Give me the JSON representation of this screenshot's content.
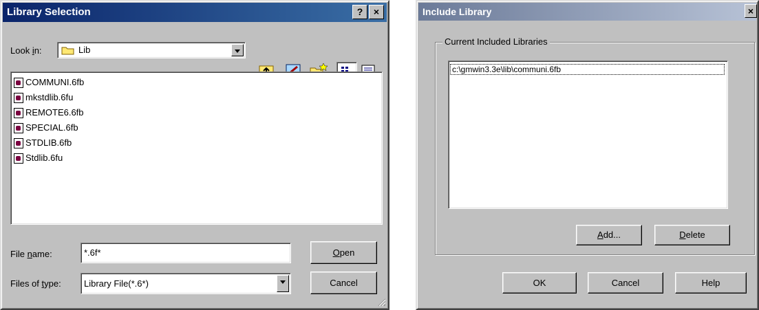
{
  "library_selection": {
    "title": "Library Selection",
    "help_label": "?",
    "close_label": "×",
    "look_in_label_pre": "Look ",
    "look_in_label_accel": "i",
    "look_in_label_post": "n:",
    "look_in_value": "Lib",
    "toolbar_icons": [
      "up-folder-icon",
      "desktop-icon",
      "new-folder-icon",
      "list-view-icon",
      "details-view-icon"
    ],
    "files": [
      "COMMUNI.6fb",
      "mkstdlib.6fu",
      "REMOTE6.6fb",
      "SPECIAL.6fb",
      "STDLIB.6fb",
      "Stdlib.6fu"
    ],
    "file_name_label_pre": "File ",
    "file_name_label_accel": "n",
    "file_name_label_post": "ame:",
    "file_name_value": "*.6f*",
    "files_of_type_label_pre": "Files of ",
    "files_of_type_label_accel": "t",
    "files_of_type_label_post": "ype:",
    "files_of_type_value": "Library File(*.6*)",
    "open_accel": "O",
    "open_rest": "pen",
    "cancel_label": "Cancel"
  },
  "include_library": {
    "title": "Include Library",
    "close_label": "×",
    "group_caption": "Current Included Libraries",
    "libraries": [
      "c:\\gmwin3.3e\\lib\\communi.6fb"
    ],
    "add_accel": "A",
    "add_rest": "dd...",
    "delete_accel": "D",
    "delete_rest": "elete",
    "ok_label": "OK",
    "cancel_label": "Cancel",
    "help_label": "Help"
  }
}
